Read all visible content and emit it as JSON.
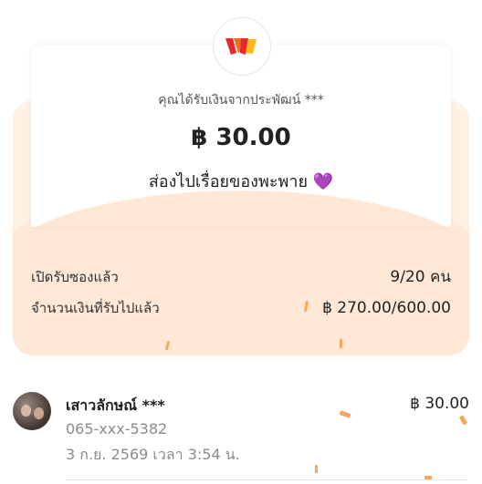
{
  "envelope": {
    "sender_text": "คุณได้รับเงินจากประพัฒน์ ***",
    "amount": "฿ 30.00",
    "message": "ส่องไปเรื่อยของพะพาย",
    "heart": "💜",
    "logo_icon": "brand-w-logo-icon",
    "opened_label": "เปิดรับซองแล้ว",
    "opened_value": "9/20 คน",
    "received_label": "จำนวนเงินที่รับไปแล้ว",
    "received_value": "฿ 270.00/600.00"
  },
  "receiver": {
    "name": "เสาวลักษณ์ ***",
    "amount": "฿ 30.00",
    "phone": "065-xxx-5382",
    "time": "3 ก.ย. 2569 เวลา 3:54 น."
  },
  "colors": {
    "envelope_bg": "#fff0e4",
    "envelope_fold": "#ffe8d6",
    "confetti": "#f5a65b",
    "heart": "#8a3ffc"
  }
}
